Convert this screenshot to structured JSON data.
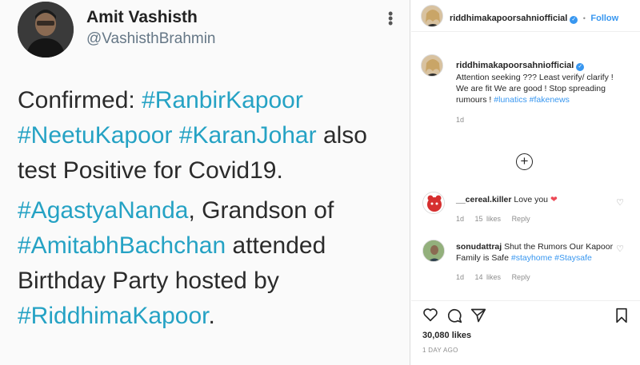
{
  "tweet": {
    "name": "Amit Vashisth",
    "handle": "@VashisthBrahmin",
    "p1_label": "Confirmed: ",
    "p1_tag1": "#RanbirKapoor",
    "p1_tag2": "#NeetuKapoor",
    "p1_tag3": "#KaranJohar",
    "p1_tail": " also test Positive for Covid19.",
    "p2_tag1": "#AgastyaNanda",
    "p2_mid": ", Grandson of ",
    "p2_tag2": "#AmitabhBachchan",
    "p2_tail": " attended Birthday Party hosted by ",
    "p2_tag3": "#RiddhimaKapoor",
    "p2_end": "."
  },
  "instagram": {
    "header": {
      "username": "riddhimakapoorsahniofficial",
      "separator": "•",
      "follow_label": "Follow"
    },
    "caption": {
      "username": "riddhimakapoorsahniofficial",
      "text": "Attention seeking ??? Least verify/ clarify ! We are fit We are good ! Stop spreading rumours ! ",
      "tag1": "#lunatics",
      "tag2": "#fakenews",
      "time": "1d"
    },
    "comments": [
      {
        "username": "__cereal.killer",
        "text": "Love you ",
        "time": "1d",
        "likes": "15 likes",
        "reply": "Reply"
      },
      {
        "username": "sonudattraj",
        "text": "Shut the Rumors Our Kapoor Family is Safe ",
        "tag1": "#stayhome",
        "tag2": "#Staysafe",
        "time": "1d",
        "likes": "14 likes",
        "reply": "Reply"
      }
    ],
    "likes_count": "30,080 likes",
    "time_ago": "1 DAY AGO",
    "colors": {
      "link": "#3897f0",
      "heart": "#ed4956",
      "tweet_hashtag": "#25a2c4"
    }
  }
}
